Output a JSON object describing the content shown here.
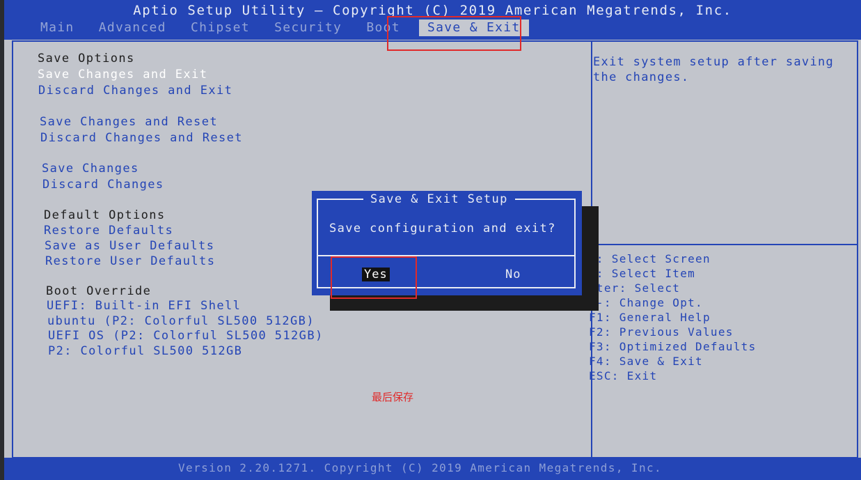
{
  "header": {
    "title": "Aptio Setup Utility – Copyright (C) 2019 American Megatrends, Inc.",
    "tabs": [
      "Main",
      "Advanced",
      "Chipset",
      "Security",
      "Boot",
      "Save & Exit"
    ],
    "active_tab": "Save & Exit"
  },
  "menu": {
    "save_options_heading": "Save Options",
    "save_changes_and_exit": "Save Changes and Exit",
    "discard_changes_and_exit": "Discard Changes and Exit",
    "save_changes_and_reset": "Save Changes and Reset",
    "discard_changes_and_reset": "Discard Changes and Reset",
    "save_changes": "Save Changes",
    "discard_changes": "Discard Changes",
    "default_options_heading": "Default Options",
    "restore_defaults": "Restore Defaults",
    "save_as_user_defaults": "Save as User Defaults",
    "restore_user_defaults": "Restore User Defaults",
    "boot_override_heading": "Boot Override",
    "boot_override_items": [
      "UEFI: Built-in EFI Shell",
      "ubuntu (P2: Colorful SL500 512GB)",
      "UEFI OS (P2: Colorful SL500 512GB)",
      "P2: Colorful SL500 512GB"
    ]
  },
  "help": {
    "text": "Exit system setup after saving the changes."
  },
  "keys": [
    "←: Select Screen",
    "↓: Select Item",
    "nter: Select",
    "/-: Change Opt.",
    "F1: General Help",
    "F2: Previous Values",
    "F3: Optimized Defaults",
    "F4: Save & Exit",
    "ESC: Exit"
  ],
  "dialog": {
    "title": "Save & Exit Setup",
    "message": "Save configuration and exit?",
    "yes_label": "Yes",
    "no_label": "No"
  },
  "annotation": {
    "note": "最后保存",
    "color": "#e02a2a"
  },
  "footer": {
    "text": "Version 2.20.1271. Copyright (C) 2019 American Megatrends, Inc."
  },
  "colors": {
    "bios_blue": "#2445b6",
    "panel_gray": "#c2c5cc",
    "highlight_red": "#e02a2a"
  }
}
